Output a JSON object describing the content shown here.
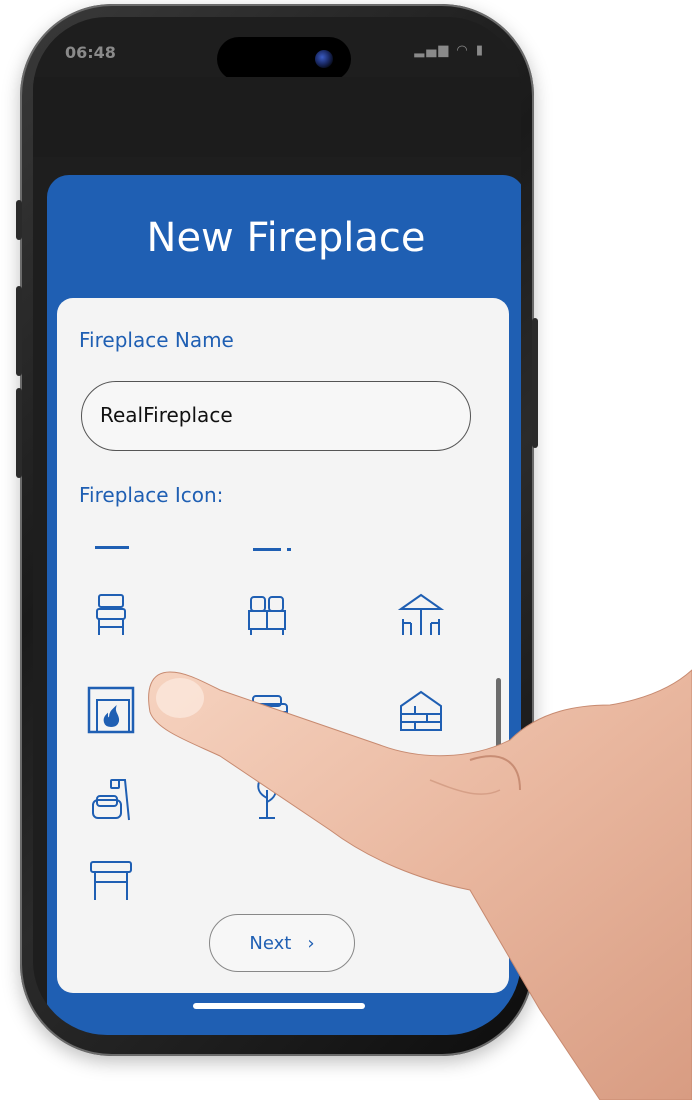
{
  "status_bar": {
    "time": "06:48",
    "icons": "▂▄▆ ◠ ▮"
  },
  "page": {
    "title": "New Fireplace"
  },
  "form": {
    "name_label": "Fireplace Name",
    "name_value": "RealFireplace",
    "icon_label": "Fireplace Icon:",
    "icons": [
      "chair-icon",
      "dresser-icon",
      "patio-umbrella-icon",
      "fireplace-icon",
      "sofa-icon",
      "house-icon",
      "armchair-lamp-icon",
      "plant-icon",
      "desk-lamp-icon",
      "table-icon"
    ],
    "selected_icon": "fireplace-icon",
    "next_label": "Next",
    "next_arrow": "›"
  },
  "colors": {
    "primary": "#1f5fb3",
    "card": "#f4f4f4"
  }
}
